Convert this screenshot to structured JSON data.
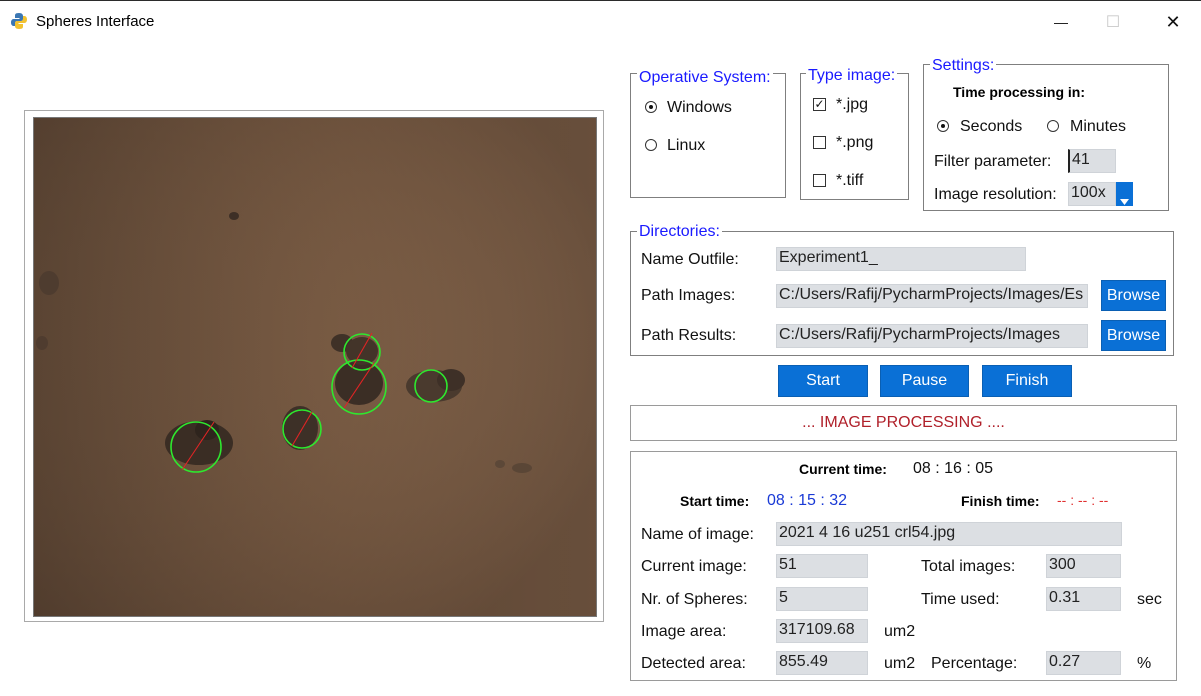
{
  "window": {
    "title": "Spheres Interface",
    "minimize": "—",
    "maximize": "☐",
    "close": "✕"
  },
  "os_group": {
    "legend": "Operative System:",
    "options": [
      {
        "label": "Windows",
        "selected": true
      },
      {
        "label": "Linux",
        "selected": false
      }
    ]
  },
  "type_group": {
    "legend": "Type image:",
    "options": [
      {
        "label": "*.jpg",
        "checked": true
      },
      {
        "label": "*.png",
        "checked": false
      },
      {
        "label": "*.tiff",
        "checked": false
      }
    ]
  },
  "settings": {
    "legend": "Settings:",
    "time_heading": "Time processing in:",
    "units": [
      {
        "label": "Seconds",
        "selected": true
      },
      {
        "label": "Minutes",
        "selected": false
      }
    ],
    "filter_label": "Filter parameter:",
    "filter_value": "41",
    "resolution_label": "Image resolution:",
    "resolution_value": "100x"
  },
  "directories": {
    "legend": "Directories:",
    "outfile_label": "Name Outfile:",
    "outfile_value": "Experiment1_",
    "images_label": "Path Images:",
    "images_value": "C:/Users/Rafij/PycharmProjects/Images/Es",
    "results_label": "Path Results:",
    "results_value": "C:/Users/Rafij/PycharmProjects/Images",
    "browse": "Browse"
  },
  "actions": {
    "start": "Start",
    "pause": "Pause",
    "finish": "Finish"
  },
  "status": "... IMAGE PROCESSING ....",
  "info": {
    "current_time_label": "Current time:",
    "current_time": "08 : 16 : 05",
    "start_time_label": "Start time:",
    "start_time": "08 : 15 : 32",
    "finish_time_label": "Finish time:",
    "finish_time": "-- : -- : --",
    "name_label": "Name of image:",
    "name_value": "2021 4 16 u251 crl54.jpg",
    "current_image_label": "Current image:",
    "current_image": "51",
    "total_images_label": "Total images:",
    "total_images": "300",
    "spheres_label": "Nr. of Spheres:",
    "spheres": "5",
    "time_used_label": "Time used:",
    "time_used": "0.31",
    "sec_unit": "sec",
    "image_area_label": "Image area:",
    "image_area": "317109.68",
    "area_unit": "um2",
    "detected_area_label": "Detected area:",
    "detected_area": "855.49",
    "detected_unit": "um2",
    "percentage_label": "Percentage:",
    "percentage": "0.27",
    "percent_unit": "%"
  },
  "colors": {
    "accent_button": "#0a70d6",
    "legend": "#1a1aff",
    "status_text": "#b0202a",
    "start_time": "#1a3ad6",
    "finish_time": "#e03030",
    "detection_circle": "#2ee82e"
  }
}
